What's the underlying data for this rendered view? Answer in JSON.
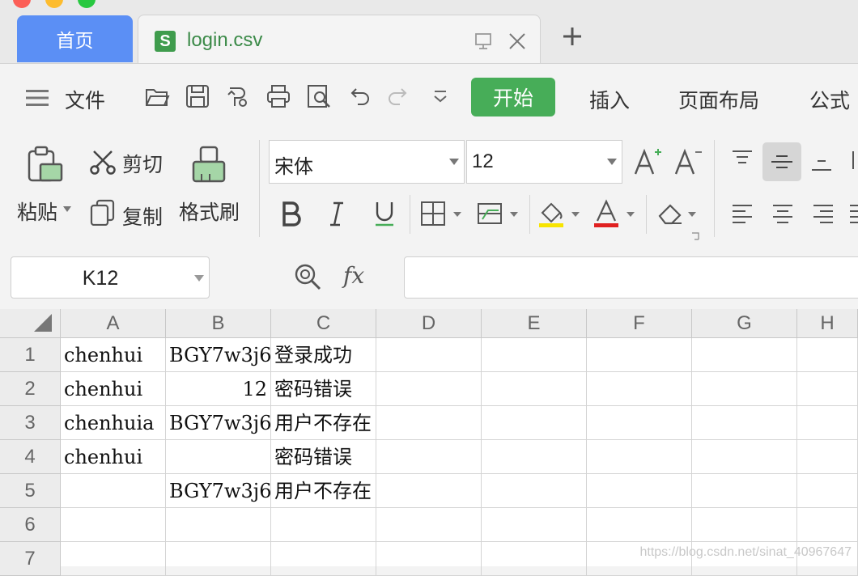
{
  "tabs": {
    "home": "首页",
    "file": "login.csv"
  },
  "menu": {
    "file": "文件",
    "start": "开始",
    "insert": "插入",
    "page_layout": "页面布局",
    "formula": "公式"
  },
  "ribbon": {
    "paste": "粘贴",
    "cut": "剪切",
    "copy": "复制",
    "format_painter": "格式刷",
    "font_name": "宋体",
    "font_size": "12"
  },
  "formula_bar": {
    "cell_ref": "K12",
    "fx": "fx",
    "value": ""
  },
  "grid": {
    "columns": [
      "A",
      "B",
      "C",
      "D",
      "E",
      "F",
      "G",
      "H"
    ],
    "rows": [
      {
        "num": "1",
        "a": "chenhui",
        "b": "BGY7w3j6",
        "c": "登录成功"
      },
      {
        "num": "2",
        "a": "chenhui",
        "b": "12",
        "c": "密码错误"
      },
      {
        "num": "3",
        "a": "chenhuia",
        "b": "BGY7w3j6",
        "c": "用户不存在"
      },
      {
        "num": "4",
        "a": "chenhui",
        "b": "",
        "c": "密码错误"
      },
      {
        "num": "5",
        "a": "",
        "b": "BGY7w3j6",
        "c": "用户不存在"
      },
      {
        "num": "6",
        "a": "",
        "b": "",
        "c": ""
      },
      {
        "num": "7",
        "a": "",
        "b": "",
        "c": ""
      }
    ]
  },
  "watermark": "https://blog.csdn.net/sinat_40967647",
  "colors": {
    "home_tab": "#5b8ff5",
    "start_button": "#47ad58",
    "file_icon": "#3f9c4d"
  }
}
